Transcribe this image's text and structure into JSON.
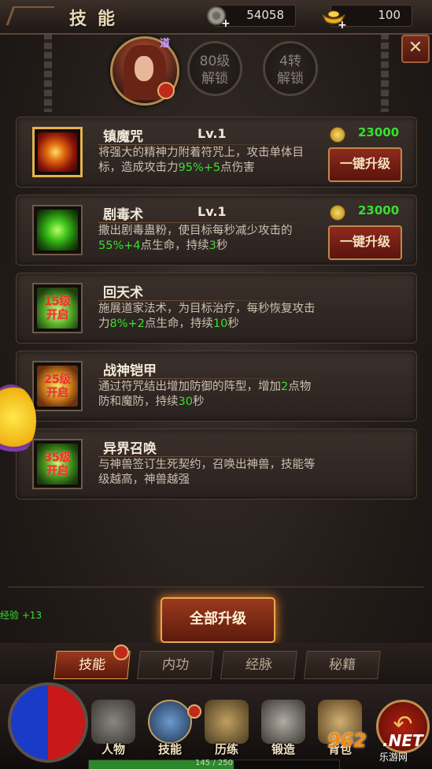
{
  "header": {
    "title": "技能",
    "resources": [
      {
        "icon": "silver-ingot-plus-icon",
        "value": "54058"
      },
      {
        "icon": "gold-ingot-plus-icon",
        "value": "100"
      }
    ],
    "close_label": "✕"
  },
  "character": {
    "class_badge": "道",
    "unlocks": [
      {
        "line1": "80级",
        "line2": "解锁"
      },
      {
        "line1": "4转",
        "line2": "解锁"
      }
    ]
  },
  "skills": [
    {
      "name": "镇魔咒",
      "level": "Lv.1",
      "cost": "23000",
      "button": "一键升级",
      "desc": [
        {
          "t": "将强大的精神力附着符咒上，攻击单体目标，造成攻击力"
        },
        {
          "t": "95%+5",
          "g": true
        },
        {
          "t": "点伤害"
        }
      ]
    },
    {
      "name": "剧毒术",
      "level": "Lv.1",
      "cost": "23000",
      "button": "一键升级",
      "desc": [
        {
          "t": "撒出剧毒蛊粉，使目标每秒减少攻击的"
        },
        {
          "t": "55%+4",
          "g": true
        },
        {
          "t": "点生命，持续"
        },
        {
          "t": "3",
          "g": true
        },
        {
          "t": "秒"
        }
      ]
    },
    {
      "name": "回天术",
      "lock": "15级\n开启",
      "desc": [
        {
          "t": "施展道家法术，为目标治疗，每秒恢复攻击力"
        },
        {
          "t": "8%+2",
          "g": true
        },
        {
          "t": "点生命，持续"
        },
        {
          "t": "10",
          "g": true
        },
        {
          "t": "秒"
        }
      ]
    },
    {
      "name": "战神铠甲",
      "lock": "25级\n开启",
      "desc": [
        {
          "t": "通过符咒结出增加防御的阵型，增加"
        },
        {
          "t": "2",
          "g": true
        },
        {
          "t": "点物防和魔防，持续"
        },
        {
          "t": "30",
          "g": true
        },
        {
          "t": "秒"
        }
      ]
    },
    {
      "name": "异界召唤",
      "lock": "35级\n开启",
      "desc": [
        {
          "t": "与神兽签订生死契约，召唤出神兽，技能等级越高，神兽越强"
        }
      ]
    }
  ],
  "exp_text": "经验 +13",
  "upgrade_all_label": "全部升级",
  "tabs": [
    "技能",
    "内功",
    "经脉",
    "秘籍"
  ],
  "nav": [
    "人物",
    "技能",
    "历练",
    "锻造",
    "背包"
  ],
  "watermark": {
    "num": "962",
    "net": ".NET",
    "sub": "乐游网"
  },
  "xp": {
    "text": "145 / 250",
    "current": 145,
    "max": 250
  },
  "colors": {
    "highlight_green": "#35e030",
    "accent_gold": "#e6b24a",
    "button_red": "#8e2a1c"
  }
}
